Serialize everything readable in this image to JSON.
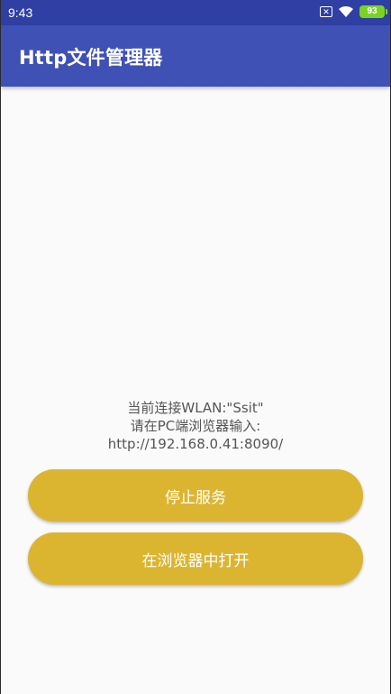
{
  "status_bar": {
    "time": "9:43",
    "icons": [
      "no-sim-icon",
      "wifi-icon",
      "battery-icon"
    ],
    "battery_level": "93"
  },
  "app_bar": {
    "title": "Http文件管理器",
    "color": "#3f51b5"
  },
  "connection": {
    "wlan_line": "当前连接WLAN:\"Ssit\"",
    "instruction_line": "请在PC端浏览器输入:",
    "url": "http://192.168.0.41:8090/"
  },
  "buttons": {
    "stop_label": "停止服务",
    "open_label": "在浏览器中打开",
    "color": "#dcb530"
  }
}
